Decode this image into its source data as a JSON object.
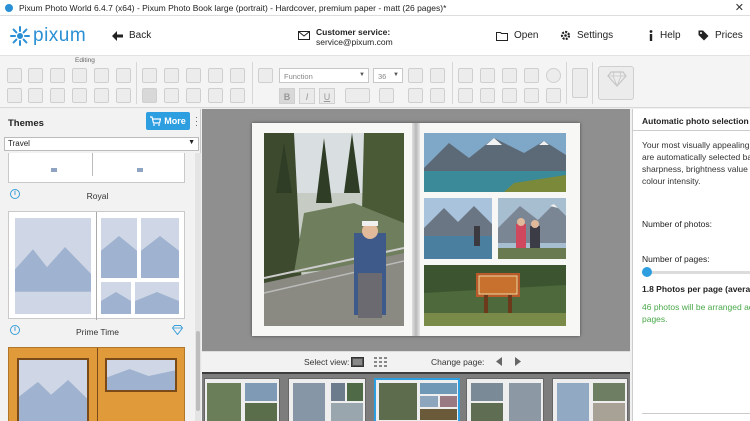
{
  "window": {
    "title": "Pixum Photo World 6.4.7 (x64) - Pixum Photo Book large (portrait) - Hardcover, premium paper - matt (26 pages)*",
    "close_glyph": "✕"
  },
  "header": {
    "logo_text": "pixum",
    "back_label": "Back",
    "customer_service_label": "Customer service:",
    "customer_service_email": "service@pixum.com",
    "open_label": "Open",
    "settings_label": "Settings",
    "help_label": "Help",
    "prices_label": "Prices"
  },
  "toolbar": {
    "editing_label": "Editing",
    "font_value": "Function",
    "font_size_value": "36",
    "bold_label": "B",
    "italic_label": "I",
    "underline_label": "U"
  },
  "left_panel": {
    "title": "Themes",
    "more_label": "More",
    "category_value": "Travel",
    "themes": [
      {
        "name": "Royal"
      },
      {
        "name": "Prime Time"
      }
    ]
  },
  "view_bar": {
    "select_view_label": "Select view:",
    "change_page_label": "Change page:"
  },
  "right_panel": {
    "title": "Automatic photo selection",
    "desc_lines": [
      "Your most visually appealing",
      "are automatically selected ba",
      "sharpness, brightness value a",
      "colour intensity."
    ],
    "num_photos_label": "Number of photos:",
    "num_pages_label": "Number of pages:",
    "pages_slider_fraction": 0.05,
    "photos_per_page": "1.8 Photos per page (avera",
    "arranged_lines": [
      "46 photos will be arranged ac",
      "pages."
    ]
  },
  "colors": {
    "accent": "#2d9ee0",
    "logo": "#2a8fd4",
    "canvas_bg": "#8f8f8f",
    "green_text": "#4aa84a"
  },
  "icons": {
    "logo": "sun-burst-icon",
    "back": "arrow-left-icon",
    "customer_service": "envelope-icon",
    "open": "folder-icon",
    "settings": "gear-icon",
    "help": "info-icon",
    "prices": "tag-icon",
    "more": "cart-icon",
    "premium": "diamond-icon"
  }
}
